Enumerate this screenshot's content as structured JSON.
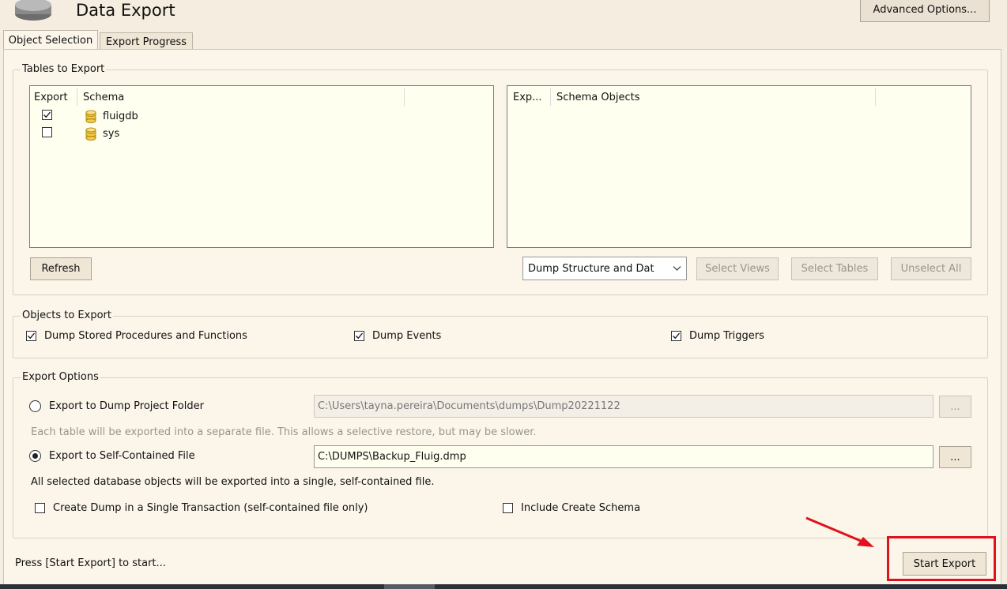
{
  "window": {
    "title": "Data Export"
  },
  "toolbar": {
    "advanced_options_label": "Advanced Options..."
  },
  "tabs": [
    {
      "label": "Object Selection",
      "active": true
    },
    {
      "label": "Export Progress",
      "active": false
    }
  ],
  "tables_to_export": {
    "group_label": "Tables to Export",
    "schema_list": {
      "columns": [
        "Export",
        "Schema"
      ],
      "rows": [
        {
          "checked": true,
          "schema": "fluigdb"
        },
        {
          "checked": false,
          "schema": "sys"
        }
      ]
    },
    "objects_list": {
      "columns": [
        "Exp...",
        "Schema Objects"
      ]
    },
    "refresh_label": "Refresh",
    "dump_select_value": "Dump Structure and Dat",
    "select_views_label": "Select Views",
    "select_tables_label": "Select Tables",
    "unselect_all_label": "Unselect All"
  },
  "objects_to_export": {
    "group_label": "Objects to Export",
    "options": [
      {
        "label": "Dump Stored Procedures and Functions",
        "checked": true
      },
      {
        "label": "Dump Events",
        "checked": true
      },
      {
        "label": "Dump Triggers",
        "checked": true
      }
    ]
  },
  "export_options": {
    "group_label": "Export Options",
    "project_folder": {
      "label": "Export to Dump Project Folder",
      "selected": false,
      "path": "C:\\Users\\tayna.pereira\\Documents\\dumps\\Dump20221122",
      "browse_label": "...",
      "hint": "Each table will be exported into a separate file. This allows a selective restore, but may be slower."
    },
    "self_contained": {
      "label": "Export to Self-Contained File",
      "selected": true,
      "path": "C:\\DUMPS\\Backup_Fluig.dmp",
      "browse_label": "...",
      "hint": "All selected database objects will be exported into a single, self-contained file."
    },
    "single_transaction": {
      "label": "Create Dump in a Single Transaction (self-contained file only)",
      "checked": false
    },
    "include_create_schema": {
      "label": "Include Create Schema",
      "checked": false
    }
  },
  "footer": {
    "status_text": "Press [Start Export] to start...",
    "start_export_label": "Start Export"
  },
  "colors": {
    "background": "#f5eddf",
    "panel": "#fbf5ea",
    "list_background": "#fffff0",
    "annotation_red": "#e0121b"
  },
  "icons": [
    "database-icon",
    "checkmark-icon",
    "chevron-down-icon",
    "arrow-annotation"
  ]
}
